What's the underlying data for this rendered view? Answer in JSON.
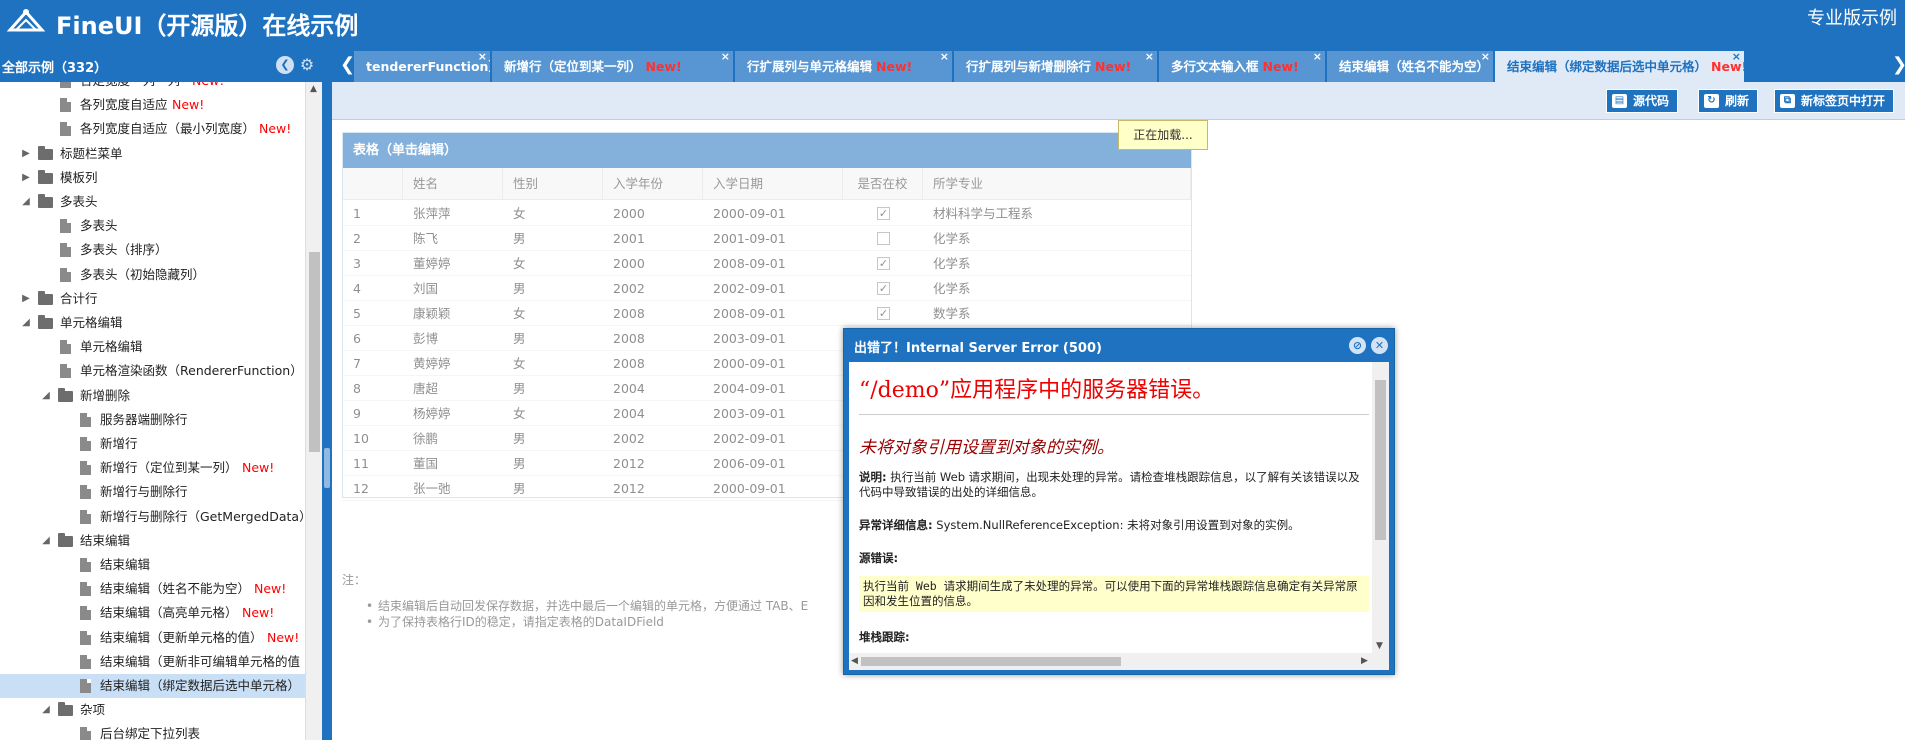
{
  "header": {
    "title": "FineUI（开源版）在线示例",
    "pro_link": "专业版示例"
  },
  "sidebar": {
    "title": "全部示例（332）",
    "items": [
      {
        "label": "合定宽度 - 列 - 列 -",
        "new": "New!"
      },
      {
        "label": "各列宽度自适应",
        "new": "New!"
      },
      {
        "label": "各列宽度自适应（最小列宽度）",
        "new": "New!"
      },
      {
        "label": "标题栏菜单",
        "new": ""
      },
      {
        "label": "模板列",
        "new": ""
      },
      {
        "label": "多表头",
        "new": ""
      },
      {
        "label": "多表头",
        "new": ""
      },
      {
        "label": "多表头（排序）",
        "new": ""
      },
      {
        "label": "多表头（初始隐藏列）",
        "new": ""
      },
      {
        "label": "合计行",
        "new": ""
      },
      {
        "label": "单元格编辑",
        "new": ""
      },
      {
        "label": "单元格编辑",
        "new": ""
      },
      {
        "label": "单元格渲染函数（RendererFunction）",
        "new": ""
      },
      {
        "label": "新增删除",
        "new": ""
      },
      {
        "label": "服务器端删除行",
        "new": ""
      },
      {
        "label": "新增行",
        "new": ""
      },
      {
        "label": "新增行（定位到某一列）",
        "new": "New!"
      },
      {
        "label": "新增行与删除行",
        "new": ""
      },
      {
        "label": "新增行与删除行（GetMergedData）",
        "new": ""
      },
      {
        "label": "结束编辑",
        "new": ""
      },
      {
        "label": "结束编辑",
        "new": ""
      },
      {
        "label": "结束编辑（姓名不能为空）",
        "new": "New!"
      },
      {
        "label": "结束编辑（高亮单元格）",
        "new": "New!"
      },
      {
        "label": "结束编辑（更新单元格的值）",
        "new": "New!"
      },
      {
        "label": "结束编辑（更新非可编辑单元格的值",
        "new": ""
      },
      {
        "label": "结束编辑（绑定数据后选中单元格）",
        "new": ""
      },
      {
        "label": "杂项",
        "new": ""
      },
      {
        "label": "后台绑定下拉列表",
        "new": ""
      }
    ]
  },
  "tabs": [
    {
      "label": "tendererFunction）",
      "new": ""
    },
    {
      "label": "新增行（定位到某一列）",
      "new": "New!"
    },
    {
      "label": "行扩展列与单元格编辑",
      "new": "New!"
    },
    {
      "label": "行扩展列与新增删除行",
      "new": "New!"
    },
    {
      "label": "多行文本输入框",
      "new": "New!"
    },
    {
      "label": "结束编辑（姓名不能为空）",
      "new": "New!"
    },
    {
      "label": "结束编辑（绑定数据后选中单元格）",
      "new": "New!"
    }
  ],
  "toolbar": {
    "source": "源代码",
    "refresh": "刷新",
    "open_new": "新标签页中打开"
  },
  "loading": "正在加载...",
  "grid": {
    "title": "表格（单击编辑）",
    "columns": [
      "姓名",
      "性别",
      "入学年份",
      "入学日期",
      "是否在校",
      "所学专业"
    ],
    "rows": [
      [
        "1",
        "张萍萍",
        "女",
        "2000",
        "2000-09-01",
        "✓",
        "材料科学与工程系"
      ],
      [
        "2",
        "陈飞",
        "男",
        "2001",
        "2001-09-01",
        "",
        "化学系"
      ],
      [
        "3",
        "董婷婷",
        "女",
        "2000",
        "2008-09-01",
        "✓",
        "化学系"
      ],
      [
        "4",
        "刘国",
        "男",
        "2002",
        "2002-09-01",
        "✓",
        "化学系"
      ],
      [
        "5",
        "康颖颖",
        "女",
        "2008",
        "2008-09-01",
        "✓",
        "数学系"
      ],
      [
        "6",
        "彭博",
        "男",
        "2008",
        "2003-09-01",
        "",
        ""
      ],
      [
        "7",
        "黄婷婷",
        "女",
        "2008",
        "2000-09-01",
        "",
        ""
      ],
      [
        "8",
        "唐超",
        "男",
        "2004",
        "2004-09-01",
        "",
        ""
      ],
      [
        "9",
        "杨婷婷",
        "女",
        "2004",
        "2003-09-01",
        "",
        ""
      ],
      [
        "10",
        "徐鹏",
        "男",
        "2002",
        "2002-09-01",
        "",
        ""
      ],
      [
        "11",
        "董国",
        "男",
        "2012",
        "2006-09-01",
        "",
        ""
      ],
      [
        "12",
        "张一弛",
        "男",
        "2012",
        "2000-09-01",
        "",
        ""
      ]
    ]
  },
  "notes": {
    "label": "注：",
    "items": [
      "结束编辑后自动回发保存数据，并选中最后一个编辑的单元格，方便通过 TAB、E",
      "为了保持表格行ID的稳定，请指定表格的DataIDField"
    ]
  },
  "error_dialog": {
    "title": "出错了！Internal Server Error (500)",
    "heading": "“/demo”应用程序中的服务器错误。",
    "subheading": "未将对象引用设置到对象的实例。",
    "desc_label": "说明:",
    "desc_text": "执行当前 Web 请求期间，出现未处理的异常。请检查堆栈跟踪信息，以了解有关该错误以及代码中导致错误的出处的详细信息。",
    "detail_label": "异常详细信息:",
    "detail_text": "System.NullReferenceException: 未将对象引用设置到对象的实例。",
    "source_label": "源错误:",
    "source_text": "执行当前 Web 请求期间生成了未处理的异常。可以使用下面的异常堆栈跟踪信息确定有关异常原因和发生位置的信息。",
    "stack_label": "堆栈跟踪:"
  }
}
